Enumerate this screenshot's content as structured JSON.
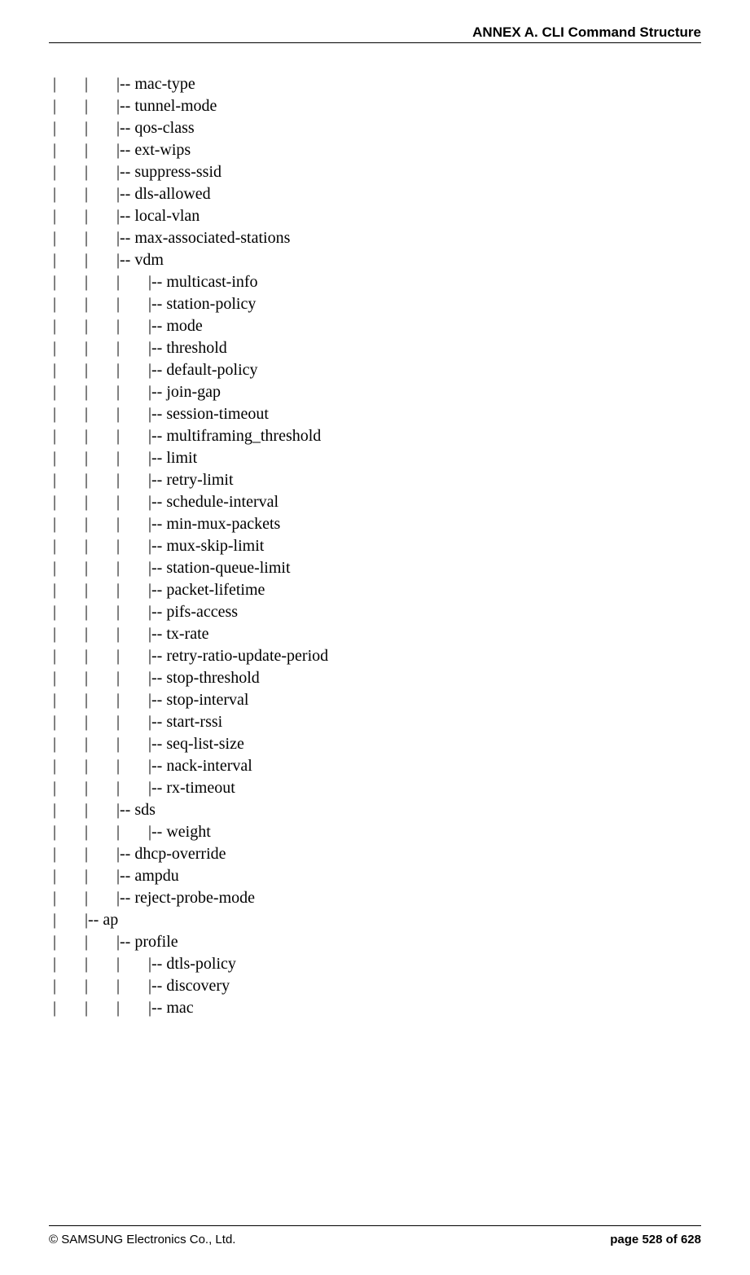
{
  "header": {
    "title": "ANNEX A. CLI Command Structure"
  },
  "lines": [
    "|       |       |-- mac-type",
    "|       |       |-- tunnel-mode",
    "|       |       |-- qos-class",
    "|       |       |-- ext-wips",
    "|       |       |-- suppress-ssid",
    "|       |       |-- dls-allowed",
    "|       |       |-- local-vlan",
    "|       |       |-- max-associated-stations",
    "|       |       |-- vdm",
    "|       |       |       |-- multicast-info",
    "|       |       |       |-- station-policy",
    "|       |       |       |-- mode",
    "|       |       |       |-- threshold",
    "|       |       |       |-- default-policy",
    "|       |       |       |-- join-gap",
    "|       |       |       |-- session-timeout",
    "|       |       |       |-- multiframing_threshold",
    "|       |       |       |-- limit",
    "|       |       |       |-- retry-limit",
    "|       |       |       |-- schedule-interval",
    "|       |       |       |-- min-mux-packets",
    "|       |       |       |-- mux-skip-limit",
    "|       |       |       |-- station-queue-limit",
    "|       |       |       |-- packet-lifetime",
    "|       |       |       |-- pifs-access",
    "|       |       |       |-- tx-rate",
    "|       |       |       |-- retry-ratio-update-period",
    "|       |       |       |-- stop-threshold",
    "|       |       |       |-- stop-interval",
    "|       |       |       |-- start-rssi",
    "|       |       |       |-- seq-list-size",
    "|       |       |       |-- nack-interval",
    "|       |       |       |-- rx-timeout",
    "|       |       |-- sds",
    "|       |       |       |-- weight",
    "|       |       |-- dhcp-override",
    "|       |       |-- ampdu",
    "|       |       |-- reject-probe-mode",
    "|       |-- ap",
    "|       |       |-- profile",
    "|       |       |       |-- dtls-policy",
    "|       |       |       |-- discovery",
    "|       |       |       |-- mac"
  ],
  "footer": {
    "copyright": "© SAMSUNG Electronics Co., Ltd.",
    "page": "page 528 of 628"
  }
}
